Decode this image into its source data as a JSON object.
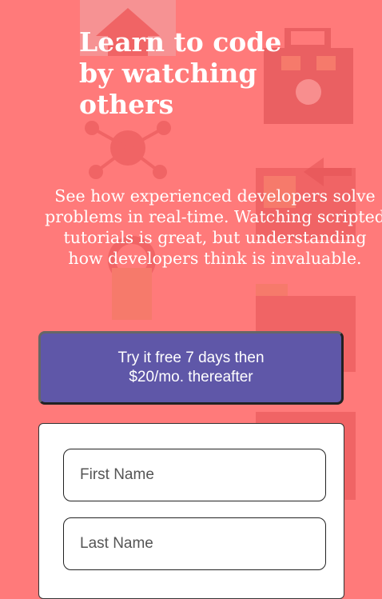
{
  "hero": {
    "title_line1": "Learn to code",
    "title_line2": "by watching",
    "title_line3": "others",
    "subtitle": "See how experienced developers solve problems in real-time. Watching scripted tutorials is great, but understanding how developers think is invaluable."
  },
  "cta": {
    "line1": "Try it free 7 days then",
    "line2": "$20/mo. thereafter"
  },
  "form": {
    "first_name_placeholder": "First Name",
    "last_name_placeholder": "Last Name"
  },
  "colors": {
    "background": "#ff7a7a",
    "cta_background": "#5f57a8",
    "decor": "#e9585a"
  }
}
